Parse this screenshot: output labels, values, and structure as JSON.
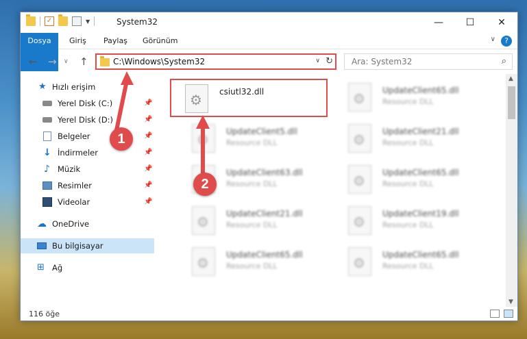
{
  "window": {
    "title": "System32",
    "minimize": "—",
    "maximize": "☐",
    "close": "✕"
  },
  "ribbon": {
    "tabs": [
      "Dosya",
      "Giriş",
      "Paylaş",
      "Görünüm"
    ],
    "help": "?"
  },
  "navbar": {
    "address": "C:\\Windows\\System32",
    "search_placeholder": "Ara: System32"
  },
  "sidebar": {
    "items": [
      {
        "label": "Hızlı erişim",
        "icon": "star-icon"
      },
      {
        "label": "Yerel Disk (C:)",
        "icon": "drive-icon",
        "pinned": true
      },
      {
        "label": "Yerel Disk (D:)",
        "icon": "drive-icon",
        "pinned": true
      },
      {
        "label": "Belgeler",
        "icon": "documents-icon",
        "pinned": true
      },
      {
        "label": "İndirmeler",
        "icon": "download-icon",
        "pinned": true
      },
      {
        "label": "Müzik",
        "icon": "music-icon",
        "pinned": true
      },
      {
        "label": "Resimler",
        "icon": "pictures-icon",
        "pinned": true
      },
      {
        "label": "Videolar",
        "icon": "videos-icon",
        "pinned": true
      },
      {
        "label": "OneDrive",
        "icon": "cloud-icon"
      },
      {
        "label": "Bu bilgisayar",
        "icon": "computer-icon"
      },
      {
        "label": "Ağ",
        "icon": "network-icon"
      }
    ]
  },
  "files": [
    {
      "name": "csiutl32.dll",
      "type": ""
    },
    {
      "name": "UpdateClient65.dll",
      "type": "Resource DLL"
    },
    {
      "name": "UpdateClient5.dll",
      "type": "Resource DLL"
    },
    {
      "name": "UpdateClient21.dll",
      "type": "Resource DLL"
    },
    {
      "name": "UpdateClient63.dll",
      "type": "Resource DLL"
    },
    {
      "name": "UpdateClient65.dll",
      "type": "Resource DLL"
    },
    {
      "name": "UpdateClient21.dll",
      "type": "Resource DLL"
    },
    {
      "name": "UpdateClient19.dll",
      "type": "Resource DLL"
    },
    {
      "name": "UpdateClient65.dll",
      "type": "Resource DLL"
    },
    {
      "name": "UpdateClient65.dll",
      "type": "Resource DLL"
    }
  ],
  "status": {
    "count": "116 öğe"
  },
  "callouts": {
    "one": "1",
    "two": "2"
  },
  "colors": {
    "accent": "#1979ca",
    "highlight": "#e04b4b",
    "selected": "#cce4f7"
  }
}
